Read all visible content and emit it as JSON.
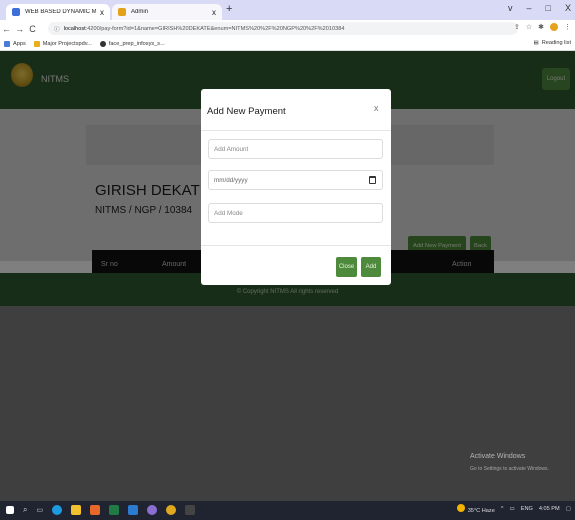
{
  "browser": {
    "tabs": [
      {
        "label": "WEB BASED DYNAMIC MANAGE",
        "close": "x",
        "favicon_color": "#3c6fd8"
      },
      {
        "label": "Admin",
        "close": "x",
        "favicon_color": "#e3a21a"
      }
    ],
    "new_tab": "+",
    "window_controls": [
      "v",
      "–",
      "□",
      "X"
    ],
    "nav": {
      "back": "←",
      "forward": "→",
      "reload": "C"
    },
    "address": {
      "host": "localhost",
      "url_rest": ":4200/pay-form?id=1&name=GIRISH%20DEKATE&enum=NITMS%20%2F%20NGP%20%2F%2010384"
    },
    "bookmarks": [
      {
        "label": "Apps",
        "color": "#4a7bd6"
      },
      {
        "label": "Major Projectspdv...",
        "color": "#e8b01c"
      },
      {
        "label": "face_prep_infosys_s...",
        "color": "#333333"
      }
    ],
    "reading_list": "Reading list"
  },
  "app": {
    "brand": "NITMS",
    "logout": "Logout",
    "student_name": "GIRISH DEKATE",
    "student_id": "NITMS / NGP / 10384",
    "buttons": {
      "add_new_payment": "Add New Payment",
      "back": "Back"
    },
    "table_headers": {
      "sr_no": "Sr no",
      "amount": "Amount",
      "action": "Action"
    },
    "footer": "© Copyright NITMS All rights reserved"
  },
  "modal": {
    "title": "Add New Payment",
    "close_x": "x",
    "amount_placeholder": "Add Amount",
    "date_placeholder": "mm/dd/yyyy",
    "mode_placeholder": "Add Mode",
    "close_button": "Close",
    "add_button": "Add"
  },
  "watermark": {
    "title": "Activate Windows",
    "subtitle": "Go to Settings to activate Windows."
  },
  "taskbar": {
    "weather": "35°C Haze",
    "lang": "ENG",
    "time": "4:05 PM"
  },
  "colors": {
    "navbar": "#305a2f",
    "button": "#4e8a3c",
    "table_header": "#111111"
  }
}
